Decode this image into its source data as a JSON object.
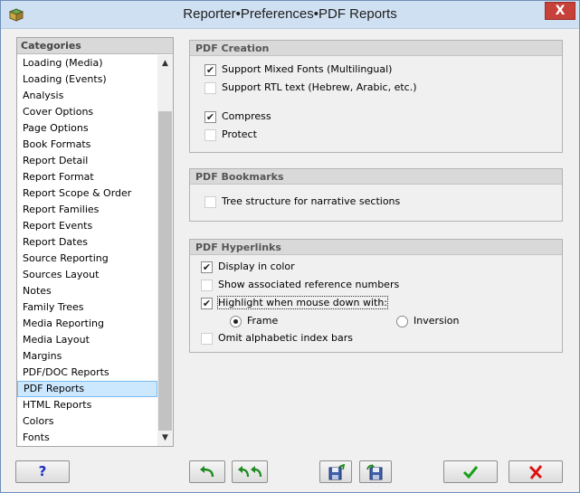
{
  "window": {
    "title": "Reporter•Preferences•PDF Reports",
    "close_label": "X"
  },
  "categories": {
    "header": "Categories",
    "items": [
      "Loading (Media)",
      "Loading (Events)",
      "Analysis",
      "Cover Options",
      "Page Options",
      "Book Formats",
      "Report Detail",
      "Report Format",
      "Report Scope & Order",
      "Report Families",
      "Report Events",
      "Report Dates",
      "Source Reporting",
      "Sources Layout",
      "Notes",
      "Family Trees",
      "Media Reporting",
      "Media Layout",
      "Margins",
      "PDF/DOC Reports",
      "PDF Reports",
      "HTML Reports",
      "Colors",
      "Fonts"
    ],
    "selected": "PDF Reports"
  },
  "pdf_creation": {
    "header": "PDF Creation",
    "mixed_fonts": {
      "label": "Support Mixed Fonts (Multilingual)",
      "checked": true
    },
    "rtl_text": {
      "label": "Support RTL text (Hebrew, Arabic, etc.)",
      "checked": false
    },
    "compress": {
      "label": "Compress",
      "checked": true
    },
    "protect": {
      "label": "Protect",
      "checked": false
    }
  },
  "pdf_bookmarks": {
    "header": "PDF Bookmarks",
    "tree_structure": {
      "label": "Tree structure for narrative sections",
      "checked": false
    }
  },
  "pdf_hyperlinks": {
    "header": "PDF Hyperlinks",
    "display_color": {
      "label": "Display in color",
      "checked": true
    },
    "show_reference": {
      "label": "Show associated reference numbers",
      "checked": false
    },
    "highlight": {
      "label": "Highlight when mouse down with:",
      "checked": true
    },
    "frame": {
      "label": "Frame",
      "selected": true
    },
    "inversion": {
      "label": "Inversion",
      "selected": false
    },
    "omit_index": {
      "label": "Omit alphabetic index bars",
      "checked": false
    }
  },
  "buttons": {
    "help_label": "?",
    "icons": [
      "undo-icon",
      "undo-all-icon",
      "save-icon",
      "load-icon",
      "ok-check-icon",
      "cancel-x-icon"
    ]
  },
  "colors": {
    "ok_green": "#18a018",
    "cancel_red": "#e01010",
    "help_blue": "#1c2fbf",
    "selection": "#cce8ff"
  }
}
